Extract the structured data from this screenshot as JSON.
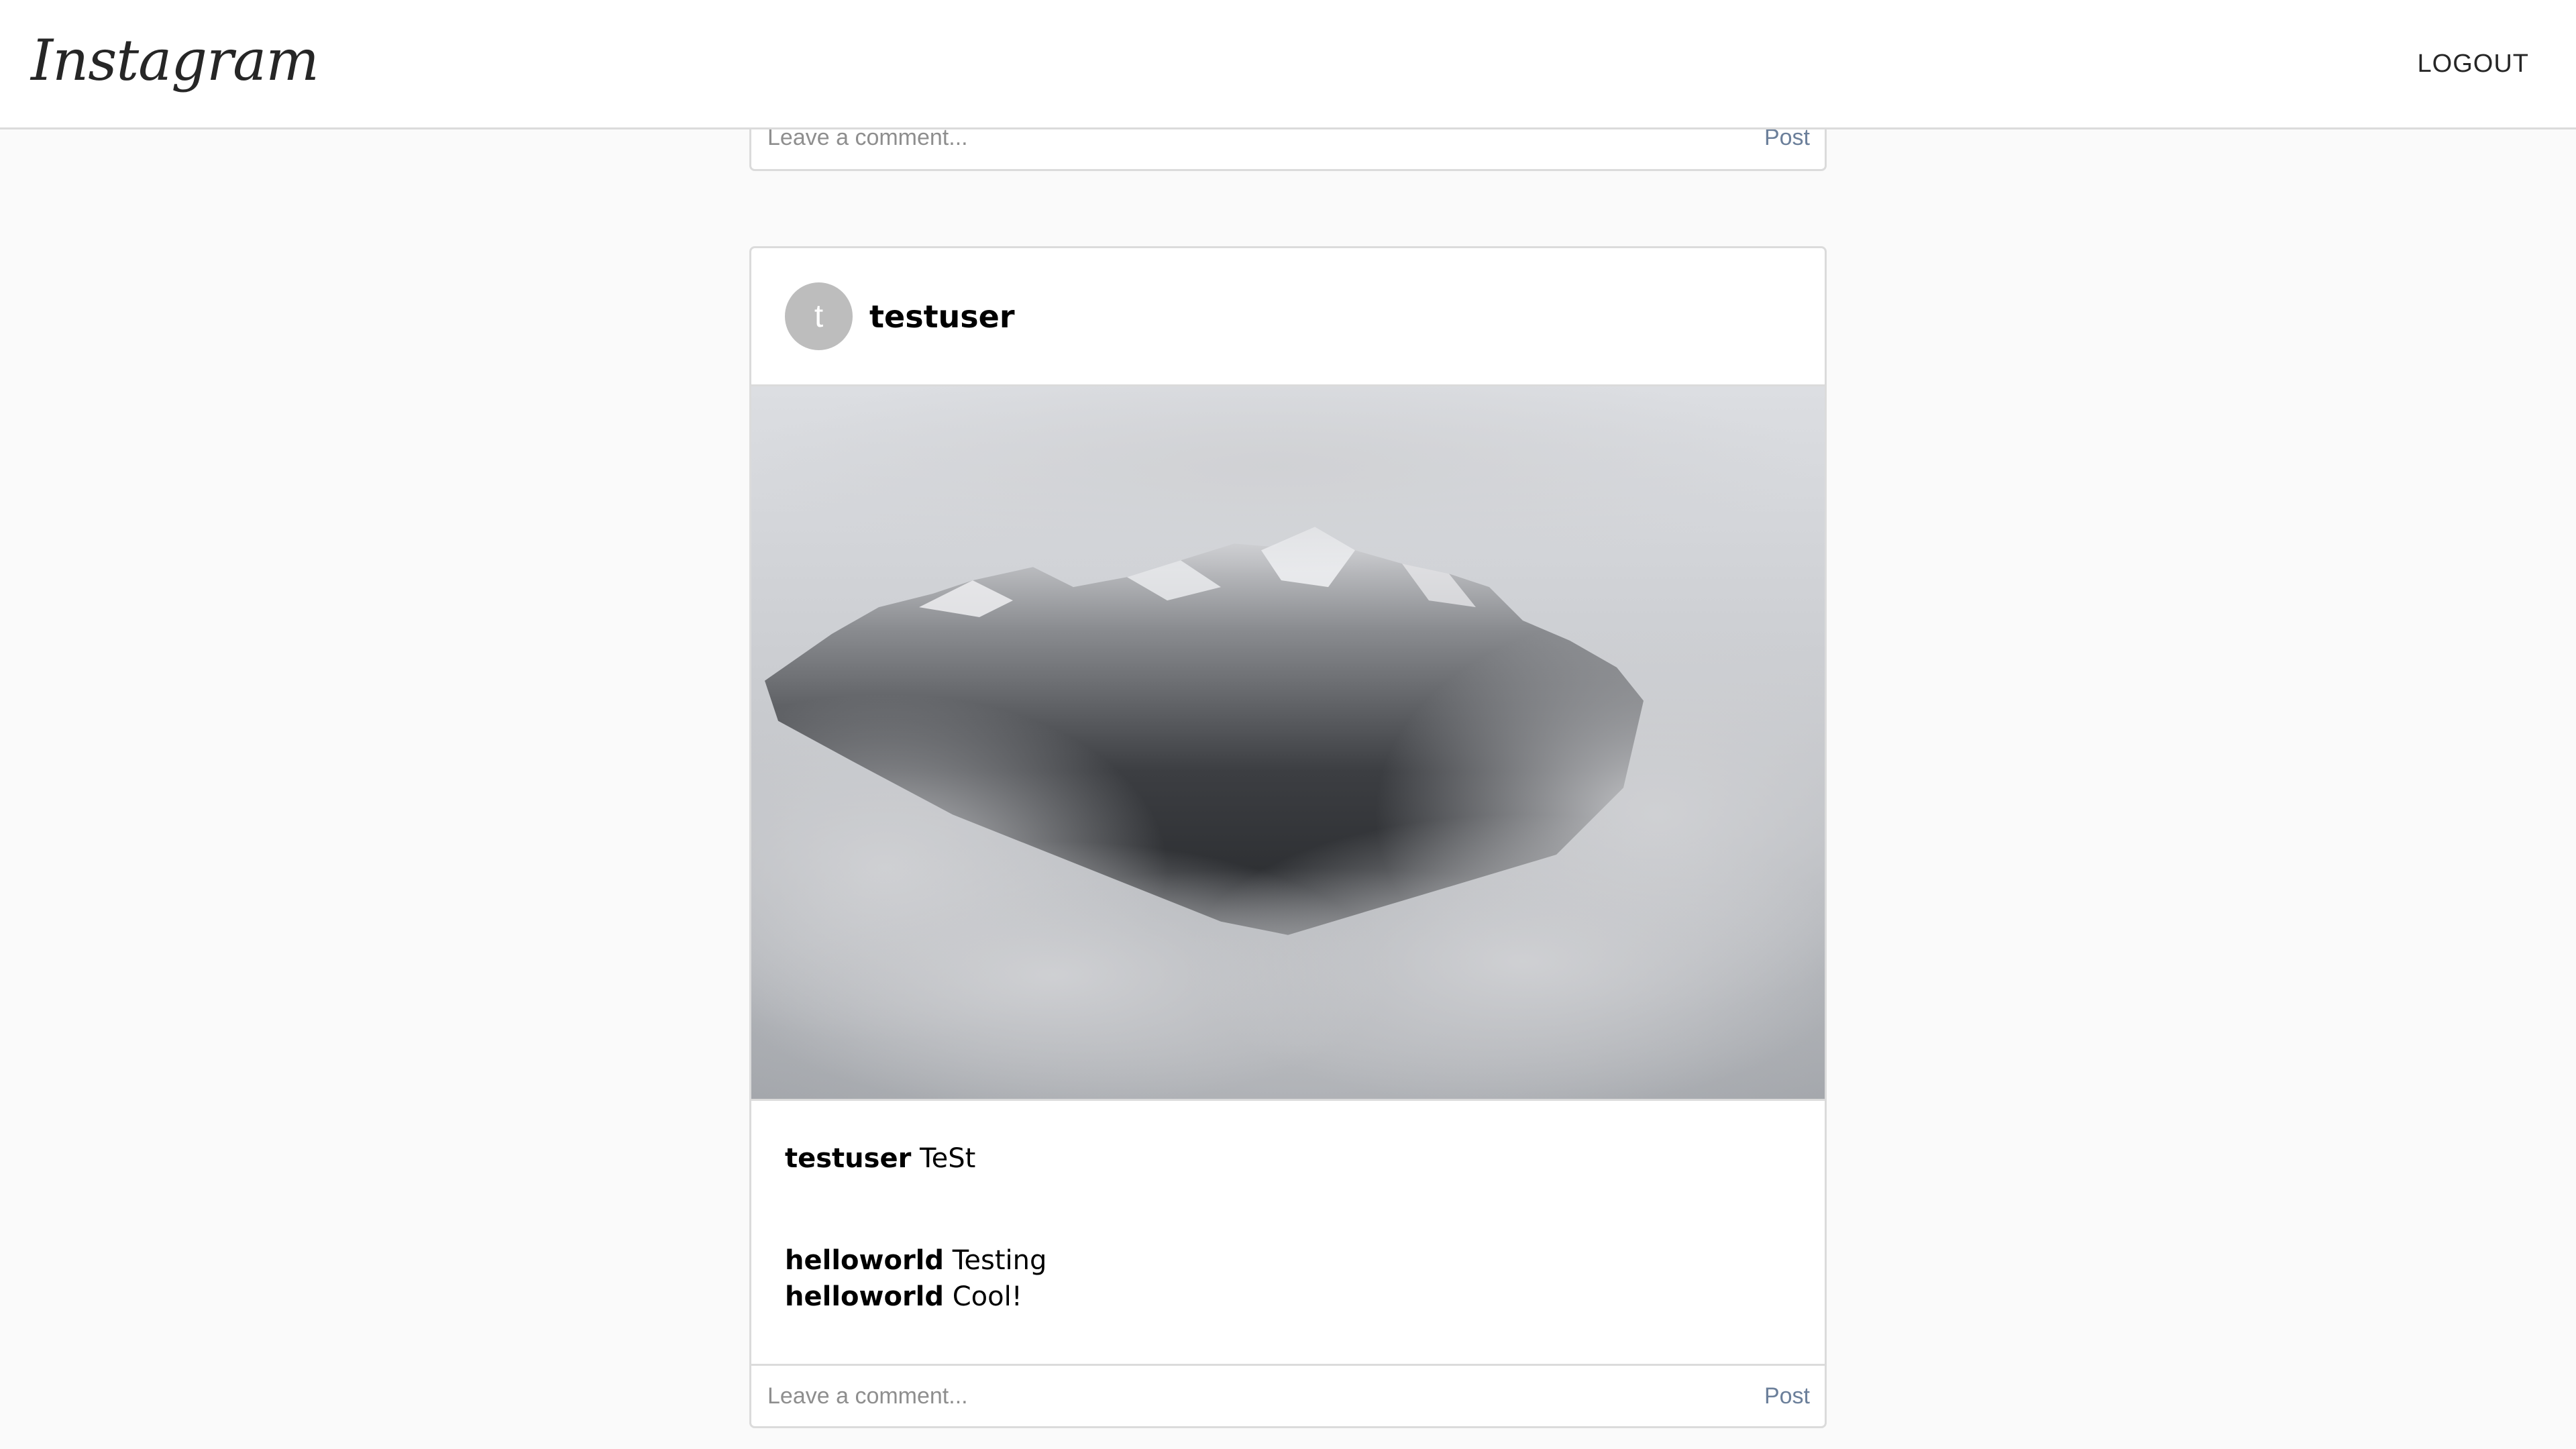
{
  "header": {
    "logo_text": "Instagram",
    "logout_label": "LOGOUT"
  },
  "previous_post": {
    "comment_placeholder": "Leave a comment...",
    "post_button": "Post"
  },
  "post": {
    "avatar_letter": "t",
    "username": "testuser",
    "image_alt": "snowy mountain peaks above clouds",
    "caption": {
      "username": "testuser",
      "text": "TeSt"
    },
    "comments": [
      {
        "username": "helloworld",
        "text": "Testing"
      },
      {
        "username": "helloworld",
        "text": "Cool!"
      }
    ],
    "comment_placeholder": "Leave a comment...",
    "post_button": "Post"
  },
  "colors": {
    "background": "#fafafa",
    "border": "#dbdbdb",
    "avatar": "#bdbdbd",
    "post_button": "#6b7f9a"
  }
}
